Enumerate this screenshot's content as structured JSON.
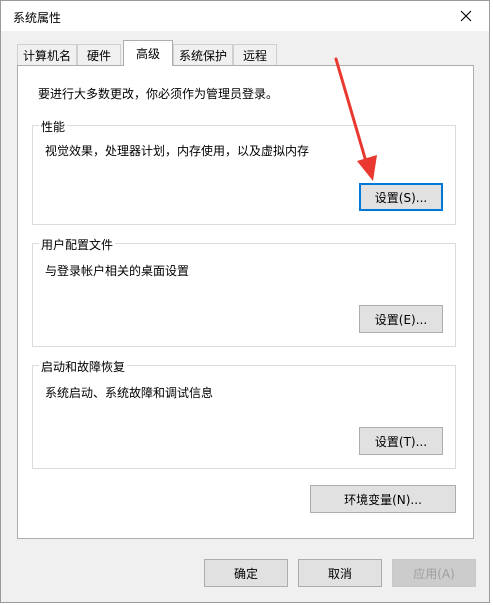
{
  "window": {
    "title": "系统属性",
    "close_icon": "close-icon"
  },
  "tabs": [
    {
      "label": "计算机名",
      "active": false
    },
    {
      "label": "硬件",
      "active": false
    },
    {
      "label": "高级",
      "active": true
    },
    {
      "label": "系统保护",
      "active": false
    },
    {
      "label": "远程",
      "active": false
    }
  ],
  "advanced": {
    "intro": "要进行大多数更改，你必须作为管理员登录。",
    "performance": {
      "title": "性能",
      "desc": "视觉效果，处理器计划，内存使用，以及虚拟内存",
      "button": "设置(S)..."
    },
    "user_profiles": {
      "title": "用户配置文件",
      "desc": "与登录帐户相关的桌面设置",
      "button": "设置(E)..."
    },
    "startup_recovery": {
      "title": "启动和故障恢复",
      "desc": "系统启动、系统故障和调试信息",
      "button": "设置(T)..."
    },
    "env_vars_button": "环境变量(N)..."
  },
  "footer": {
    "ok": "确定",
    "cancel": "取消",
    "apply": "应用(A)"
  },
  "colors": {
    "arrow": "#e8382f",
    "focus": "#0078d7",
    "window_bg": "#f0f0f0"
  }
}
